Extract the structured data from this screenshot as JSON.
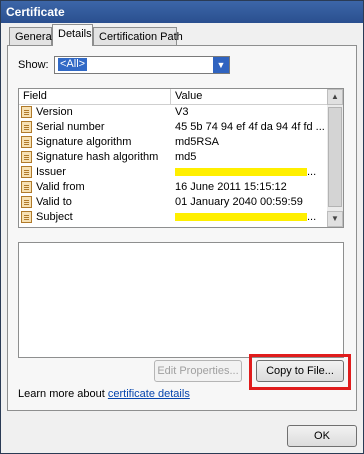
{
  "window": {
    "title": "Certificate"
  },
  "tabs": [
    {
      "label": "General"
    },
    {
      "label": "Details"
    },
    {
      "label": "Certification Path"
    }
  ],
  "show": {
    "label": "Show:",
    "value": "<All>"
  },
  "columns": {
    "field": "Field",
    "value": "Value"
  },
  "rows": [
    {
      "field": "Version",
      "value": "V3"
    },
    {
      "field": "Serial number",
      "value": "45 5b 74 94 ef 4f da 94 4f fd ..."
    },
    {
      "field": "Signature algorithm",
      "value": "md5RSA"
    },
    {
      "field": "Signature hash algorithm",
      "value": "md5"
    },
    {
      "field": "Issuer",
      "value": "...",
      "redacted": true
    },
    {
      "field": "Valid from",
      "value": "16 June 2011 15:15:12"
    },
    {
      "field": "Valid to",
      "value": "01 January 2040 00:59:59"
    },
    {
      "field": "Subject",
      "value": "...",
      "redacted": true
    }
  ],
  "buttons": {
    "edit_properties": "Edit Properties...",
    "copy_to_file": "Copy to File...",
    "ok": "OK"
  },
  "learn_more": {
    "prefix": "Learn more about ",
    "link": "certificate details"
  },
  "colors": {
    "highlight": "#ffef00",
    "callout": "#e01c1c",
    "selection": "#3169c6"
  }
}
